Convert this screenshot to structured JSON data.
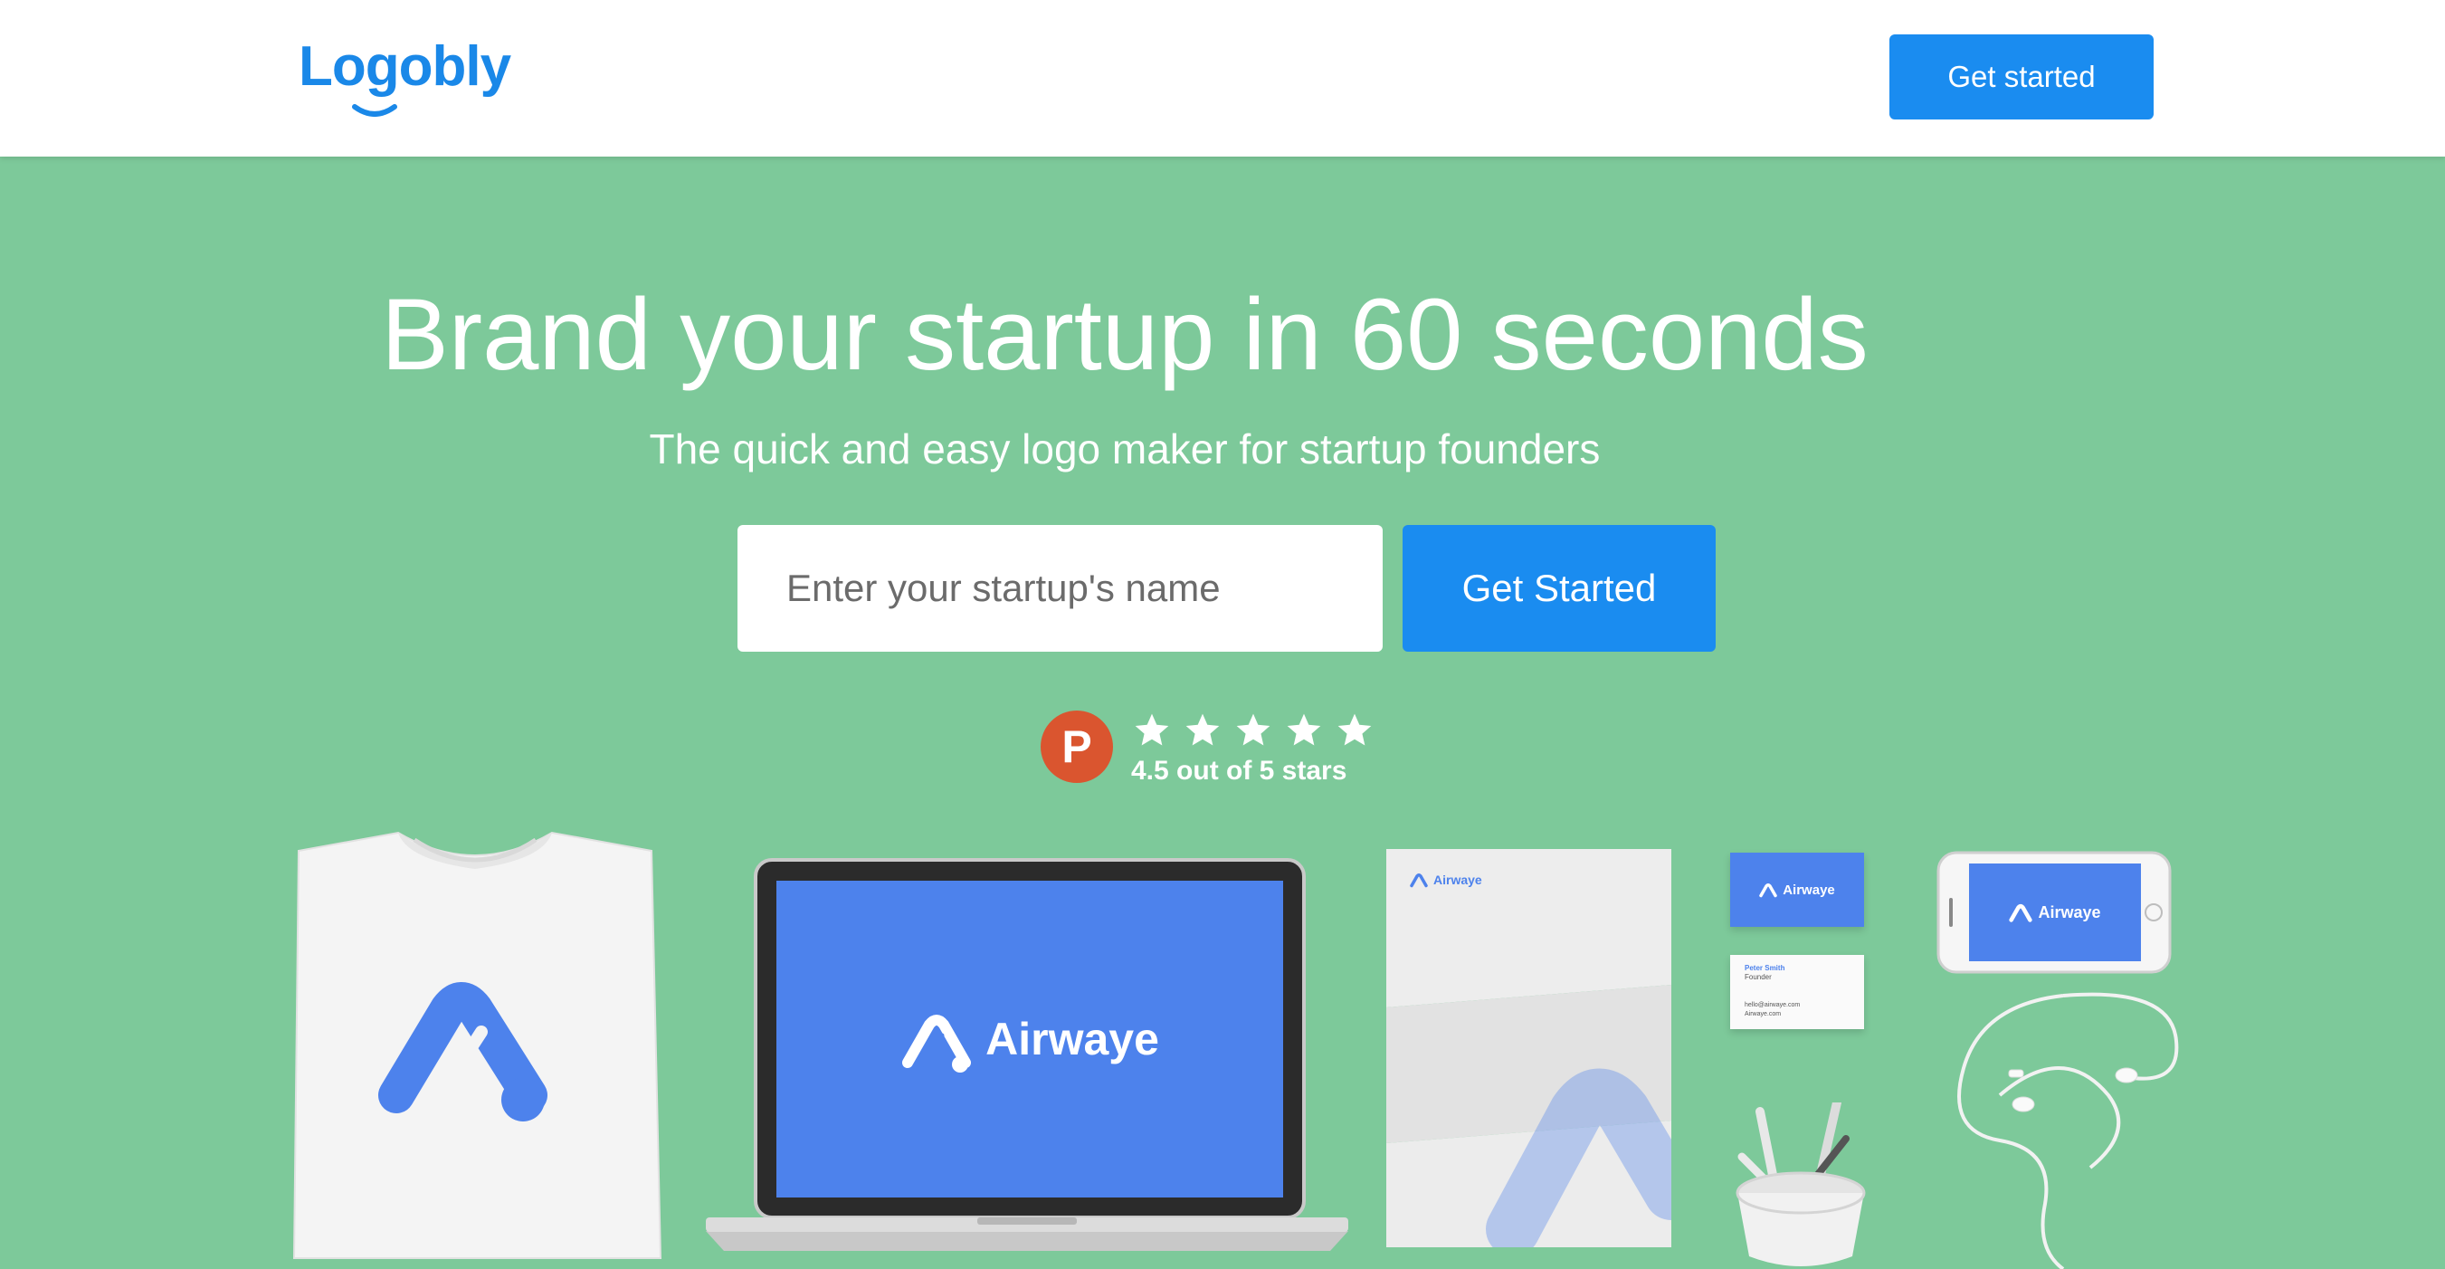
{
  "header": {
    "logo_text": "Logobly",
    "cta_label": "Get started"
  },
  "hero": {
    "title": "Brand your startup in 60 seconds",
    "subtitle": "The quick and easy logo maker for startup founders",
    "input_placeholder": "Enter your startup's name",
    "input_value": "",
    "submit_label": "Get Started"
  },
  "rating": {
    "badge_letter": "P",
    "stars": 5,
    "text": "4.5 out of 5 stars"
  },
  "mockups": {
    "brand_name": "Airwaye",
    "card_name": "Peter Smith",
    "card_title": "Founder",
    "card_email": "hello@airwaye.com",
    "card_site": "Airwaye.com"
  },
  "colors": {
    "background": "#7dc99a",
    "primary": "#1a8cf0",
    "logo": "#1a88e8",
    "product_hunt": "#da552f",
    "mockup_brand": "#4d82ec"
  }
}
